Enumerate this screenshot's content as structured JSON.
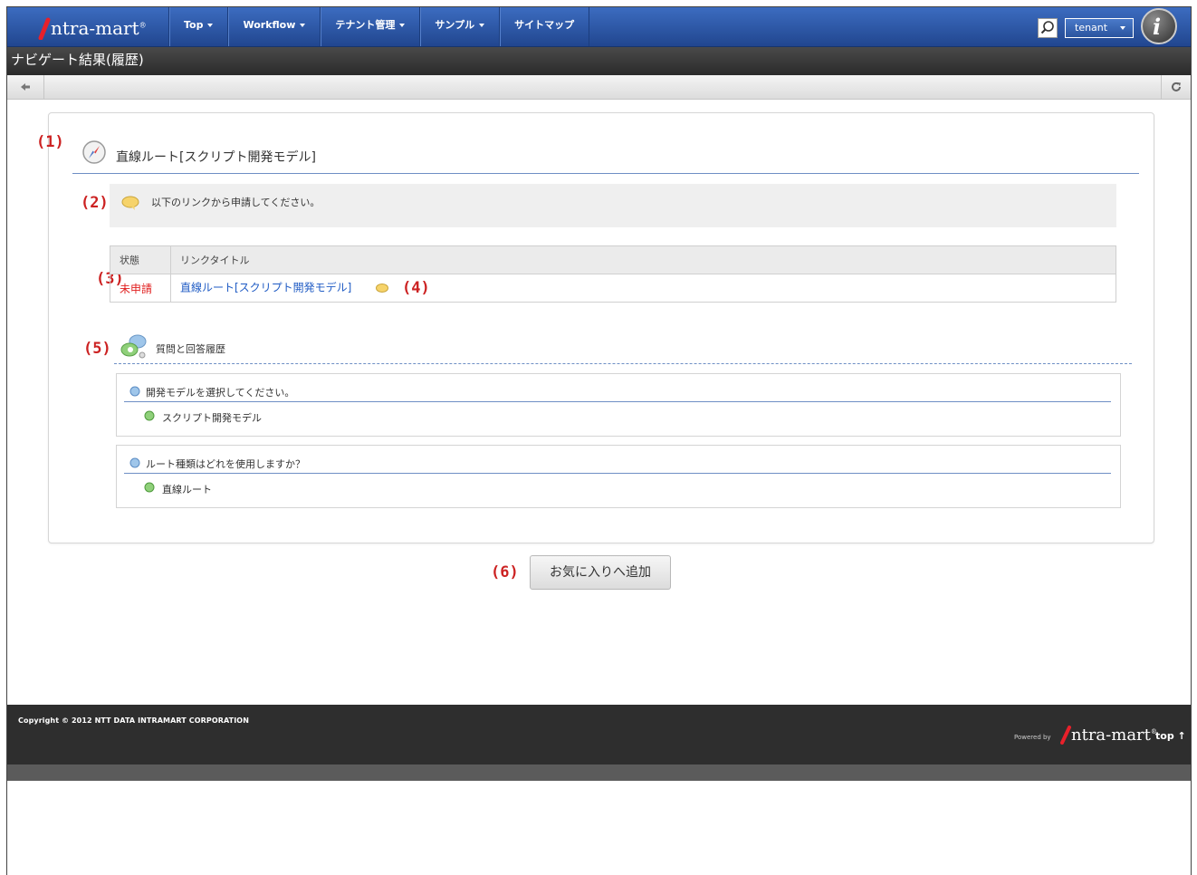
{
  "header": {
    "logo_text": "ntra-mart",
    "logo_mark": "®",
    "nav": [
      {
        "label": "Top",
        "dropdown": true
      },
      {
        "label": "Workflow",
        "dropdown": true
      },
      {
        "label": "テナント管理",
        "dropdown": true
      },
      {
        "label": "サンプル",
        "dropdown": true
      },
      {
        "label": "サイトマップ",
        "dropdown": false
      }
    ],
    "tenant_label": "tenant"
  },
  "page": {
    "title": "ナビゲート結果(履歴)"
  },
  "annotations": [
    "(1)",
    "(2)",
    "(3)",
    "(4)",
    "(5)",
    "(6)"
  ],
  "route": {
    "title": "直線ルート[スクリプト開発モデル]"
  },
  "message": {
    "text": "以下のリンクから申請してください。"
  },
  "link_table": {
    "headers": [
      "状態",
      "リンクタイトル"
    ],
    "rows": [
      {
        "status": "未申請",
        "title": "直線ルート[スクリプト開発モデル]"
      }
    ]
  },
  "qa": {
    "title": "質問と回答履歴",
    "items": [
      {
        "question": "開発モデルを選択してください。",
        "answer": "スクリプト開発モデル"
      },
      {
        "question": "ルート種類はどれを使用しますか？",
        "answer": "直線ルート"
      }
    ]
  },
  "actions": {
    "favorite_label": "お気に入りへ追加"
  },
  "footer": {
    "copyright": "Copyright © 2012 NTT DATA INTRAMART CORPORATION",
    "powered_by": "Powered by",
    "logo_text": "ntra-mart",
    "top_link": "top ↑"
  },
  "colors": {
    "nav_blue": "#2d5aa8",
    "annotation_red": "#cc2222",
    "status_red": "#e02020",
    "link_blue": "#1f5bc4"
  }
}
